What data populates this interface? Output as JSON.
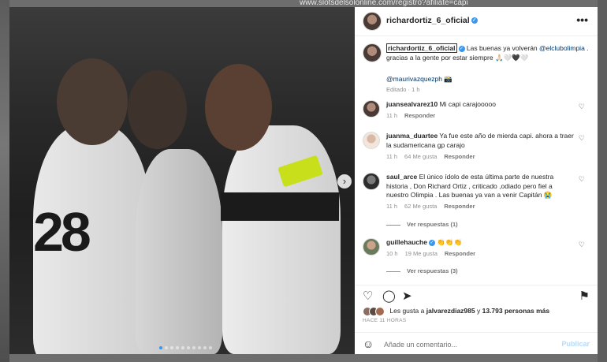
{
  "background": {
    "url_fragment": "www.slotsdelsolonline.com/registro?afiliate=capi"
  },
  "post": {
    "author": "richardortiz_6_oficial",
    "more_icon": "•••",
    "next_icon": "›",
    "carousel_total": 10,
    "carousel_active": 0,
    "photo_text": "28"
  },
  "caption": {
    "username": "richardortiz_6_oficial",
    "text_before": " Las buenas ya volverán ",
    "mention": "@elclubolimpia",
    "text_after": " . gracias a la gente por estar siempre 🙏🏻🤍🖤🤍",
    "credit": "@maurivazquezph 📸",
    "edited": "Editado",
    "time": "1 h"
  },
  "comments": [
    {
      "username": "juansealvarez10",
      "text": "Mi capi carajooooo",
      "time": "11 h",
      "likes": "",
      "reply": "Responder",
      "verified": false,
      "replies": ""
    },
    {
      "username": "juanma_duartee",
      "text": "Ya fue este año de mierda capi. ahora a traer la sudamericana gp carajo",
      "time": "11 h",
      "likes": "64 Me gusta",
      "reply": "Responder",
      "verified": false,
      "replies": ""
    },
    {
      "username": "saul_arce",
      "text": "El único ídolo de esta última parte de nuestra historia , Don Richard Ortiz , criticado ,odiado pero fiel a nuestro Olimpia . Las buenas ya van a venir Capitán 😭",
      "time": "11 h",
      "likes": "62 Me gusta",
      "reply": "Responder",
      "verified": false,
      "replies": "Ver respuestas (1)"
    },
    {
      "username": "guillehauche",
      "text": "👏👏👏",
      "time": "10 h",
      "likes": "19 Me gusta",
      "reply": "Responder",
      "verified": true,
      "replies": "Ver respuestas (3)"
    }
  ],
  "actions": {
    "like_icon": "♡",
    "comment_icon": "◯",
    "share_icon": "➤",
    "save_icon": "⚑"
  },
  "likes": {
    "prefix": "Les gusta a",
    "user": "jalvarezdiaz985",
    "suffix": "y",
    "count": "13.793 personas más"
  },
  "time_ago": "HACE 11 HORAS",
  "comment_box": {
    "emoji_icon": "☺",
    "placeholder": "Añade un comentario...",
    "post_label": "Publicar"
  }
}
